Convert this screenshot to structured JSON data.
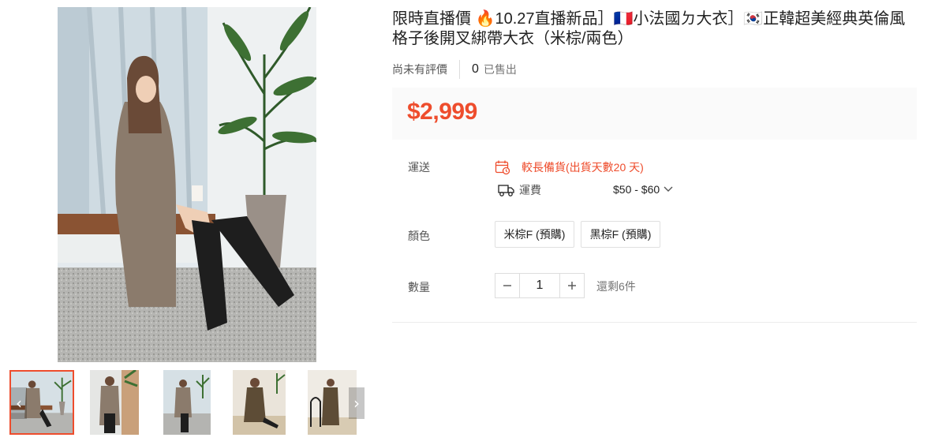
{
  "product": {
    "title": "限時直播價 🔥10.27直播新品］🇫🇷小法國ㄉ大衣］🇰🇷正韓超美經典英倫風格子後開叉綁帶大衣（米棕/兩色）",
    "rating_text": "尚未有評價",
    "sold_count": "0",
    "sold_label": "已售出",
    "price": "$2,999"
  },
  "shipping": {
    "label": "運送",
    "warning": "較長備貨(出貨天數20 天)",
    "fee_label": "運費",
    "fee_range": "$50 - $60"
  },
  "color": {
    "label": "顏色",
    "options": [
      "米棕F (預購)",
      "黑棕F (預購)"
    ]
  },
  "quantity": {
    "label": "數量",
    "value": "1",
    "minus_icon": "−",
    "plus_icon": "+",
    "stock_text": "還剩6件"
  },
  "gallery": {
    "thumbnail_count": 5,
    "active_index": 0,
    "prev_icon": "‹",
    "next_icon": "›"
  },
  "colors": {
    "accent": "#ee4d2d",
    "price_bg": "#fafafa"
  }
}
